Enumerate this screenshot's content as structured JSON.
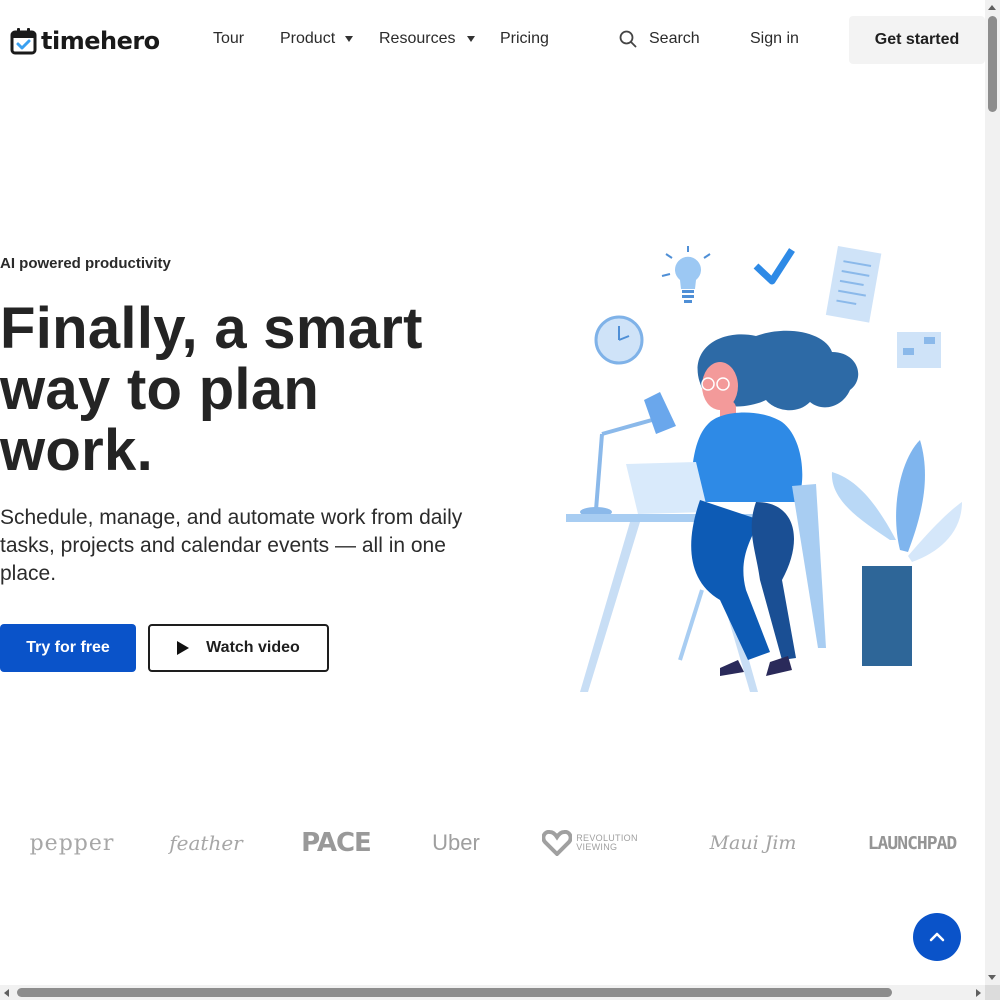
{
  "brand": {
    "name": "timehero",
    "logo_icon": "calendar-check-icon"
  },
  "nav": {
    "tour": "Tour",
    "product": "Product",
    "resources": "Resources",
    "pricing": "Pricing",
    "search": "Search",
    "sign_in": "Sign in",
    "get_started": "Get started"
  },
  "hero": {
    "eyebrow": "AI powered productivity",
    "title": "Finally, a smart way to plan work.",
    "subtitle": "Schedule, manage, and automate work from daily tasks, projects and calendar events — all in one place.",
    "primary_cta": "Try for free",
    "secondary_cta": "Watch video",
    "illustration": "woman-working-at-desk-illustration"
  },
  "customer_logos": {
    "pepper": "pepper",
    "feather": "feather",
    "pace": "PACE",
    "uber": "Uber",
    "revolution_line1": "REVOLUTION",
    "revolution_line2": "VIEWING",
    "maui_jim": "Maui Jim",
    "launchpad": "LAUNCHPAD"
  },
  "back_to_top": {
    "icon": "chevron-up-icon"
  },
  "colors": {
    "primary": "#0a53c9",
    "text": "#242424",
    "button_light": "#f3f3f3",
    "logo_gray": "#a7a7a7"
  }
}
